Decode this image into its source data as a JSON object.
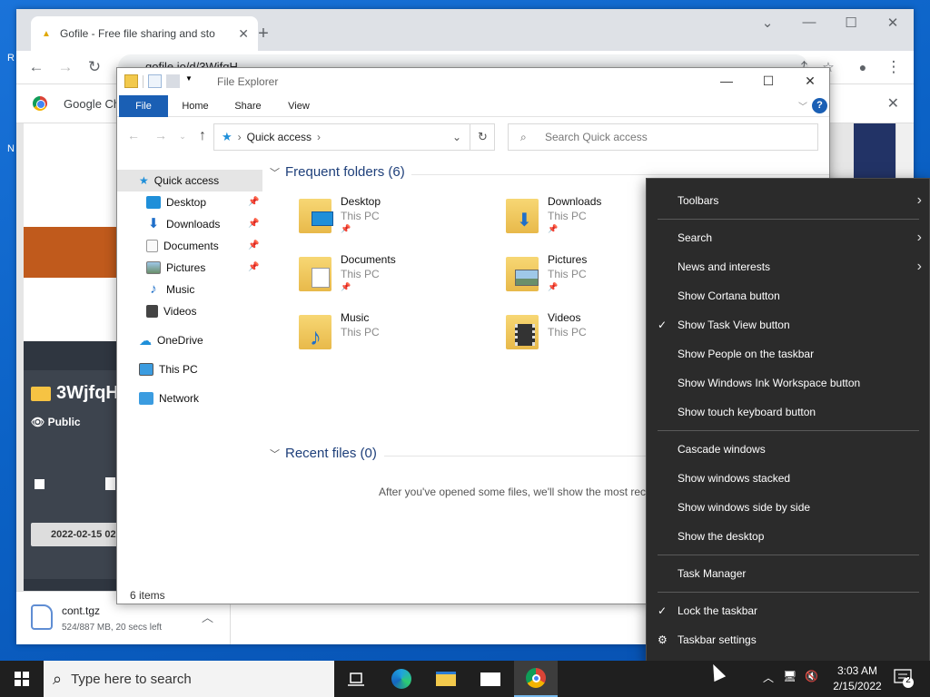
{
  "desktop": {
    "left_fragments": [
      "R",
      "N"
    ]
  },
  "chrome": {
    "tab_title": "Gofile - Free file sharing and sto",
    "url": "gofile.io/d/3WjfqH",
    "infobar_text": "Google Ch",
    "page": {
      "folder_title": "3WjfqH",
      "visibility": "Public",
      "date": "2022-02-15 02"
    },
    "download": {
      "name": "cont.tgz",
      "status": "524/887 MB, 20 secs left"
    }
  },
  "explorer": {
    "title": "File Explorer",
    "ribbon_tabs": [
      "File",
      "Home",
      "Share",
      "View"
    ],
    "address": "Quick access",
    "search_placeholder": "Search Quick access",
    "nav": {
      "quick_access": "Quick access",
      "pinned": [
        "Desktop",
        "Downloads",
        "Documents",
        "Pictures"
      ],
      "unpinned": [
        "Music",
        "Videos"
      ],
      "onedrive": "OneDrive",
      "thispc": "This PC",
      "network": "Network"
    },
    "frequent_header": "Frequent folders (6)",
    "folders": [
      {
        "name": "Desktop",
        "location": "This PC",
        "pinned": true
      },
      {
        "name": "Downloads",
        "location": "This PC",
        "pinned": true
      },
      {
        "name": "Documents",
        "location": "This PC",
        "pinned": true
      },
      {
        "name": "Pictures",
        "location": "This PC",
        "pinned": true
      },
      {
        "name": "Music",
        "location": "This PC",
        "pinned": false
      },
      {
        "name": "Videos",
        "location": "This PC",
        "pinned": false
      }
    ],
    "recent_header": "Recent files (0)",
    "recent_empty_text": "After you've opened some files, we'll show the most rec",
    "status": "6 items"
  },
  "context_menu": {
    "items": [
      {
        "label": "Toolbars",
        "submenu": true
      },
      {
        "label": "Search",
        "submenu": true
      },
      {
        "label": "News and interests",
        "submenu": true
      },
      {
        "label": "Show Cortana button"
      },
      {
        "label": "Show Task View button",
        "checked": true
      },
      {
        "label": "Show People on the taskbar"
      },
      {
        "label": "Show Windows Ink Workspace button"
      },
      {
        "label": "Show touch keyboard button"
      },
      {
        "label": "Cascade windows"
      },
      {
        "label": "Show windows stacked"
      },
      {
        "label": "Show windows side by side"
      },
      {
        "label": "Show the desktop"
      },
      {
        "label": "Task Manager"
      },
      {
        "label": "Lock the taskbar",
        "checked": true
      },
      {
        "label": "Taskbar settings",
        "icon": "gear-icon"
      }
    ]
  },
  "taskbar": {
    "search_placeholder": "Type here to search",
    "time": "3:03 AM",
    "date": "2/15/2022",
    "notification_count": "2"
  },
  "colors": {
    "accent": "#1a5fb4",
    "taskbar": "#1f1f1f",
    "menu_bg": "#2b2b2b"
  }
}
